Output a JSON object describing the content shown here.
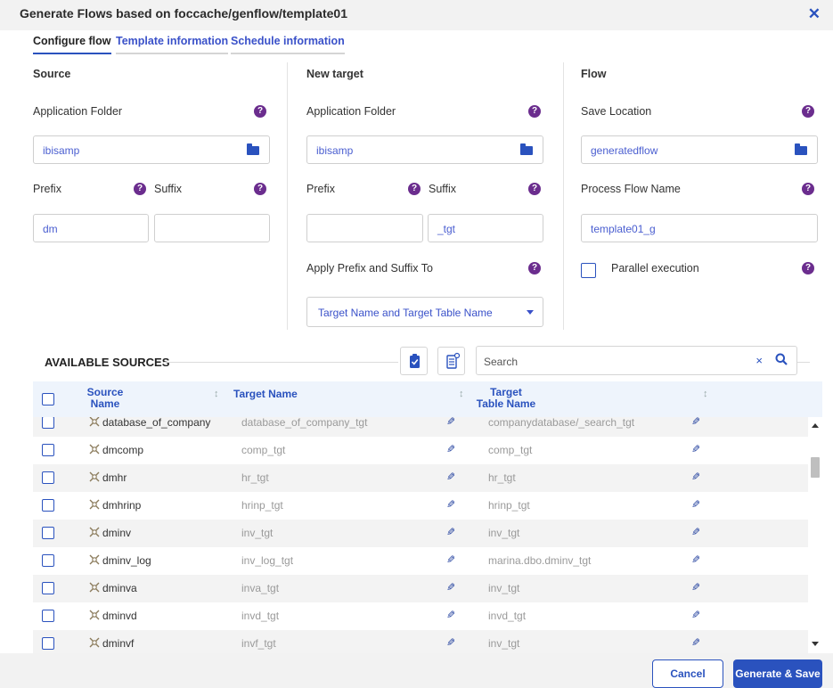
{
  "dialog": {
    "title": "Generate Flows based on foccache/genflow/template01"
  },
  "tabs": [
    {
      "label": "Configure flow"
    },
    {
      "label": "Template information"
    },
    {
      "label": "Schedule information"
    }
  ],
  "source": {
    "header": "Source",
    "app_folder_label": "Application Folder",
    "app_folder_value": "ibisamp",
    "prefix_label": "Prefix",
    "suffix_label": "Suffix",
    "prefix_value": "dm",
    "suffix_value": ""
  },
  "target": {
    "header": "New target",
    "app_folder_label": "Application Folder",
    "app_folder_value": "ibisamp",
    "prefix_label": "Prefix",
    "suffix_label": "Suffix",
    "prefix_value": "",
    "suffix_value": "_tgt",
    "apply_label": "Apply Prefix and Suffix To",
    "apply_value": "Target Name and Target Table Name"
  },
  "flow": {
    "header": "Flow",
    "save_location_label": "Save Location",
    "save_location_value": "generatedflow",
    "process_flow_label": "Process Flow Name",
    "process_flow_value": "template01_g",
    "parallel_label": "Parallel execution"
  },
  "sources": {
    "title": "AVAILABLE SOURCES",
    "search_placeholder": "Search",
    "clear_glyph": "×",
    "columns": {
      "source_name_1": "Source",
      "source_name_2": "Name",
      "target_name": "Target Name",
      "target_table_1": "Target",
      "target_table_2": "Table Name"
    },
    "rows": [
      {
        "source": "database_of_company",
        "target": "database_of_company_tgt",
        "table": "companydatabase/_search_tgt"
      },
      {
        "source": "dmcomp",
        "target": "comp_tgt",
        "table": "comp_tgt"
      },
      {
        "source": "dmhr",
        "target": "hr_tgt",
        "table": "hr_tgt"
      },
      {
        "source": "dmhrinp",
        "target": "hrinp_tgt",
        "table": "hrinp_tgt"
      },
      {
        "source": "dminv",
        "target": "inv_tgt",
        "table": "inv_tgt"
      },
      {
        "source": "dminv_log",
        "target": "inv_log_tgt",
        "table": "marina.dbo.dminv_tgt"
      },
      {
        "source": "dminva",
        "target": "inva_tgt",
        "table": "inv_tgt"
      },
      {
        "source": "dminvd",
        "target": "invd_tgt",
        "table": "invd_tgt"
      },
      {
        "source": "dminvf",
        "target": "invf_tgt",
        "table": "inv_tgt"
      }
    ]
  },
  "footer": {
    "cancel_label": "Cancel",
    "generate_label": "Generate & Save"
  },
  "colors": {
    "accent": "#2a52be",
    "help": "#6b2d8e",
    "header_bg": "#eef4fc"
  }
}
